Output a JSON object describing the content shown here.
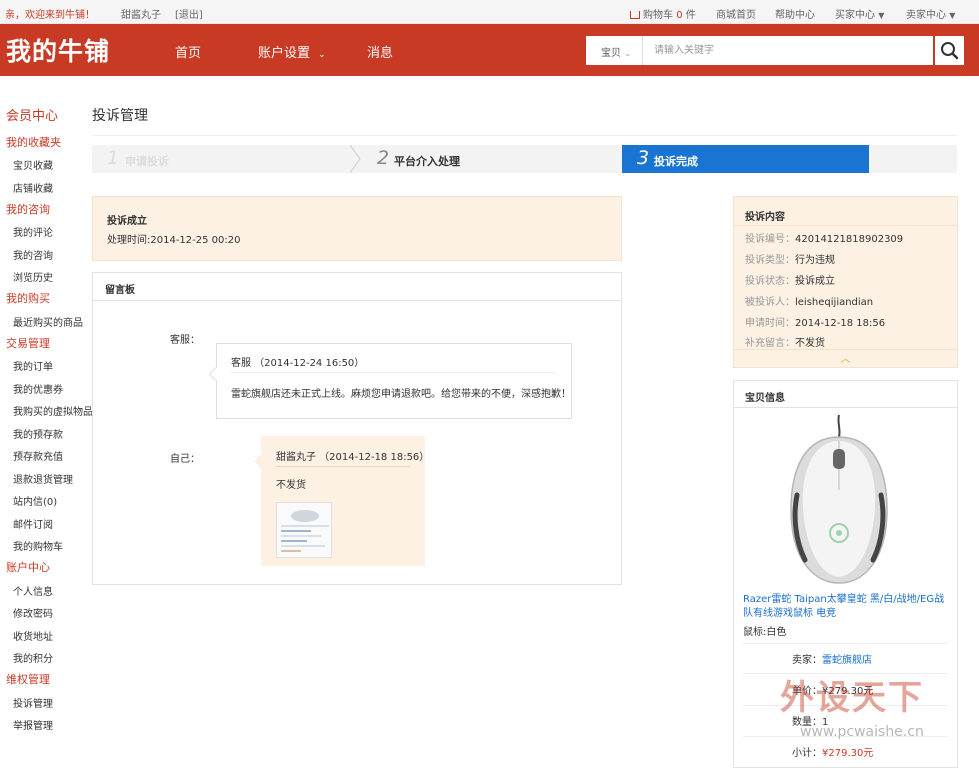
{
  "topbar": {
    "welcome": "亲，欢迎来到牛铺！",
    "username": "甜酱丸子",
    "logout": "[退出]",
    "cart_label": "购物车",
    "cart_count": "0",
    "cart_unit": "件",
    "mall_home": "商城首页",
    "help": "帮助中心",
    "buyer_center": "买家中心",
    "seller_center": "卖家中心"
  },
  "header": {
    "logo": "我的牛铺",
    "nav": [
      "首页",
      "账户设置",
      "消息"
    ],
    "search_category": "宝贝",
    "search_placeholder": "请输入关键字"
  },
  "sidebar": {
    "title": "会员中心",
    "groups": [
      {
        "label": "我的收藏夹",
        "items": [
          "宝贝收藏",
          "店铺收藏"
        ]
      },
      {
        "label": "我的咨询",
        "items": [
          "我的评论",
          "我的咨询",
          "浏览历史"
        ]
      },
      {
        "label": "我的购买",
        "items": [
          "最近购买的商品"
        ]
      },
      {
        "label": "交易管理",
        "items": [
          "我的订单",
          "我的优惠券",
          "我购买的虚拟物品",
          "我的预存款",
          "预存款充值",
          "退款退货管理",
          "站内信(0)",
          "邮件订阅",
          "我的购物车"
        ]
      },
      {
        "label": "账户中心",
        "items": [
          "个人信息",
          "修改密码",
          "收货地址",
          "我的积分"
        ]
      },
      {
        "label": "维权管理",
        "items": [
          "投诉管理",
          "举报管理"
        ]
      }
    ]
  },
  "main": {
    "page_title": "投诉管理",
    "steps": [
      {
        "num": "1",
        "label": "申请投诉"
      },
      {
        "num": "2",
        "label": "平台介入处理"
      },
      {
        "num": "3",
        "label": "投诉完成"
      }
    ],
    "result": {
      "status": "投诉成立",
      "time": "处理时间:2014-12-25 00:20"
    },
    "board": {
      "title": "留言板",
      "messages": [
        {
          "who": "客服：",
          "header": "客服 （2014-12-24 16:50）",
          "body": "雷蛇旗舰店还未正式上线。麻烦您申请退款吧。给您带来的不便，深感抱歉！"
        },
        {
          "who": "自己：",
          "header": "甜酱丸子 （2014-12-18 18:56）",
          "body": "不发货"
        }
      ]
    }
  },
  "complaint": {
    "title": "投诉内容",
    "rows": [
      {
        "k": "投诉编号：",
        "v": "42014121818902309"
      },
      {
        "k": "投诉类型：",
        "v": "行为违规"
      },
      {
        "k": "投诉状态：",
        "v": "投诉成立"
      },
      {
        "k": "被投诉人：",
        "v": "leisheqijiandian"
      },
      {
        "k": "申请时间：",
        "v": "2014-12-18 18:56"
      },
      {
        "k": "补充留言：",
        "v": "不发货"
      }
    ]
  },
  "product": {
    "title": "宝贝信息",
    "name": "Razer雷蛇 Taipan太攀皇蛇 黑/白/战地/EG战队有线游戏鼠标 电竞",
    "attr": "鼠标:白色",
    "seller_label": "卖家：",
    "seller": "雷蛇旗舰店",
    "price_label": "单价：",
    "price": "¥279.30元",
    "qty_label": "数量：",
    "qty": "1",
    "subtotal_label": "小计：",
    "subtotal": "¥279.30元"
  },
  "watermark": {
    "logo": "外设天下",
    "url": "www.pcwaishe.cn"
  },
  "colors": {
    "brand_red": "#c93a24",
    "step_active": "#1a75d2",
    "panel_bg": "#fdf1e4",
    "link_blue": "#1a6fc9"
  }
}
